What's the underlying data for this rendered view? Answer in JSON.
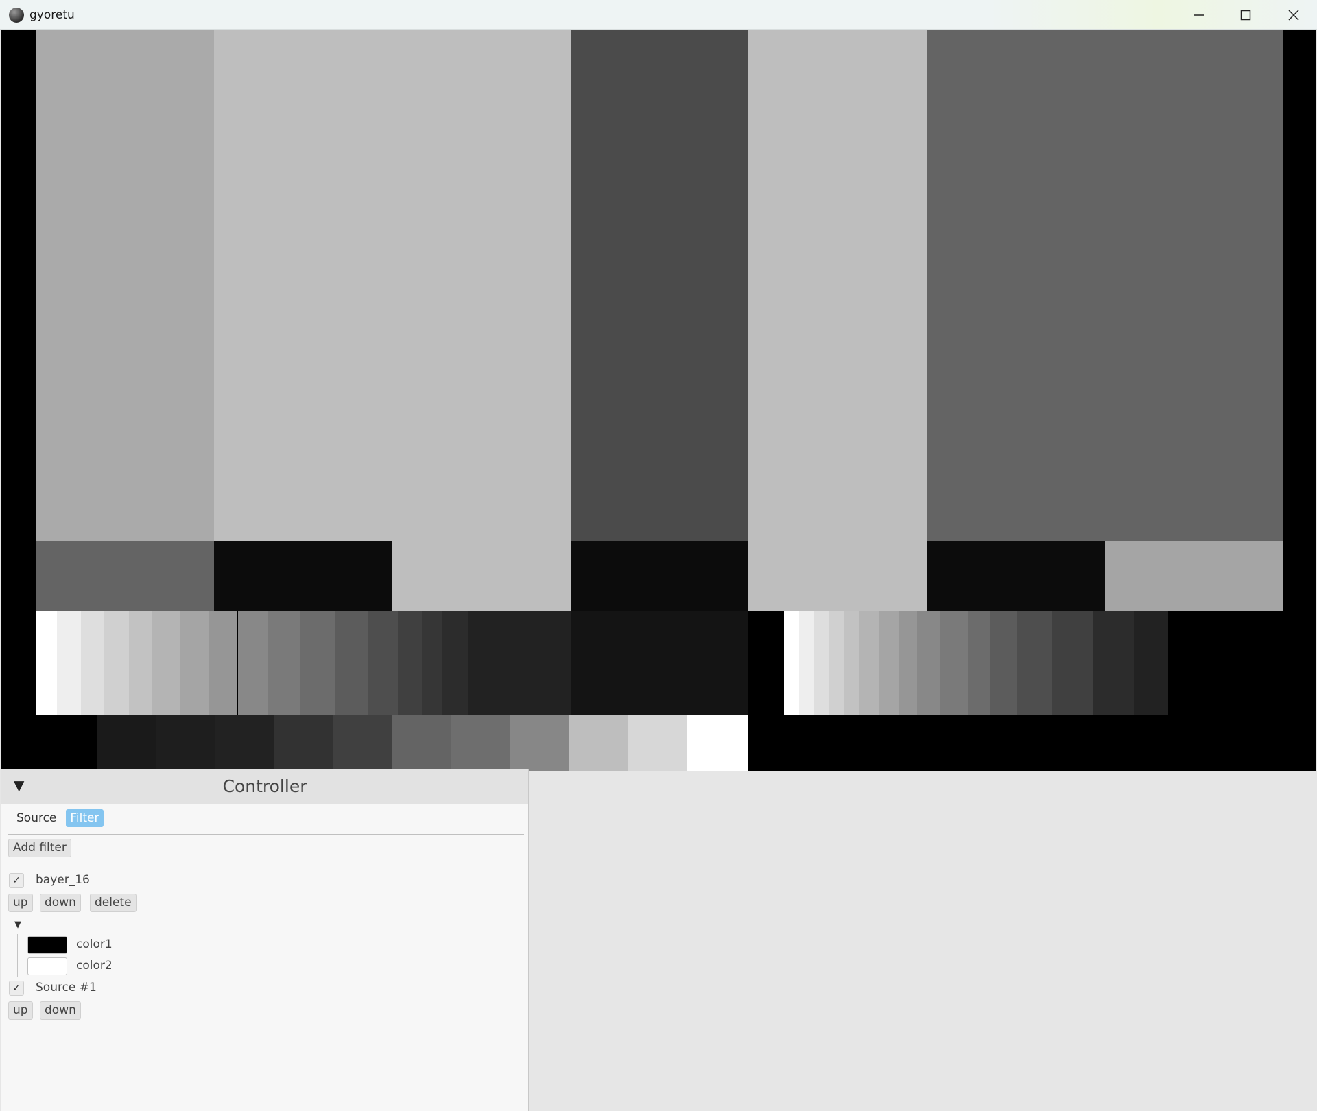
{
  "window": {
    "title": "gyoretu"
  },
  "icons": {
    "app": "app-icon",
    "minimize": "minimize-icon",
    "maximize": "maximize-icon",
    "close": "close-icon",
    "collapse": "collapse-triangle-icon",
    "check": "check-icon"
  },
  "controller": {
    "title": "Controller",
    "collapse_glyph": "▼",
    "tabs": [
      {
        "label": "Source",
        "active": false
      },
      {
        "label": "Filter",
        "active": true
      }
    ],
    "add_filter_label": "Add filter",
    "filters": [
      {
        "checked": true,
        "name": "bayer_16",
        "buttons": [
          "up",
          "down",
          "delete"
        ],
        "params": [
          {
            "label": "color1",
            "value": "#000000"
          },
          {
            "label": "color2",
            "value": "#ffffff"
          }
        ]
      },
      {
        "checked": true,
        "name": "Source #1",
        "buttons": [
          "up",
          "down"
        ]
      }
    ],
    "check_glyph": "✓",
    "expand_glyph": "▼"
  },
  "colors": {
    "active_tab": "#84c5f0",
    "canvas_bg": "#000000",
    "panel_bg": "#f7f7f7"
  }
}
